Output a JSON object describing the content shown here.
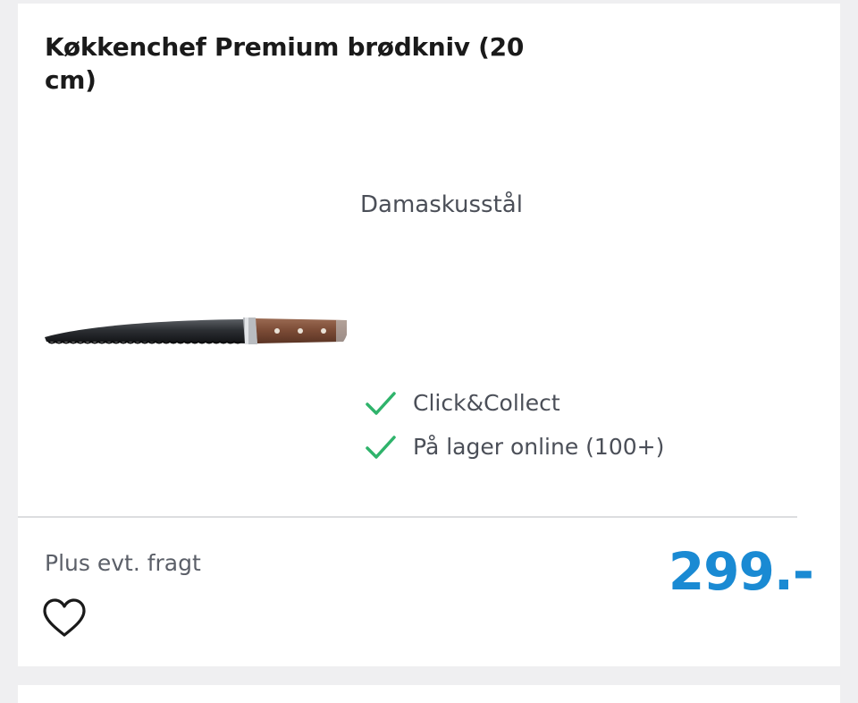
{
  "product": {
    "title": "Køkkenchef Premium brødkniv (20 cm)",
    "material": "Damaskusstål",
    "image_icon": "bread-knife-image"
  },
  "availability": [
    {
      "label": "Click&Collect",
      "icon": "check-icon"
    },
    {
      "label": "På lager online (100+)",
      "icon": "check-icon"
    }
  ],
  "footer": {
    "shipping_note": "Plus evt. fragt",
    "price": "299.-",
    "favorite_icon": "heart-outline-icon"
  },
  "colors": {
    "price": "#1a8ad3",
    "check": "#2fb36b",
    "text": "#1a1a1a",
    "muted": "#4b4f58"
  }
}
